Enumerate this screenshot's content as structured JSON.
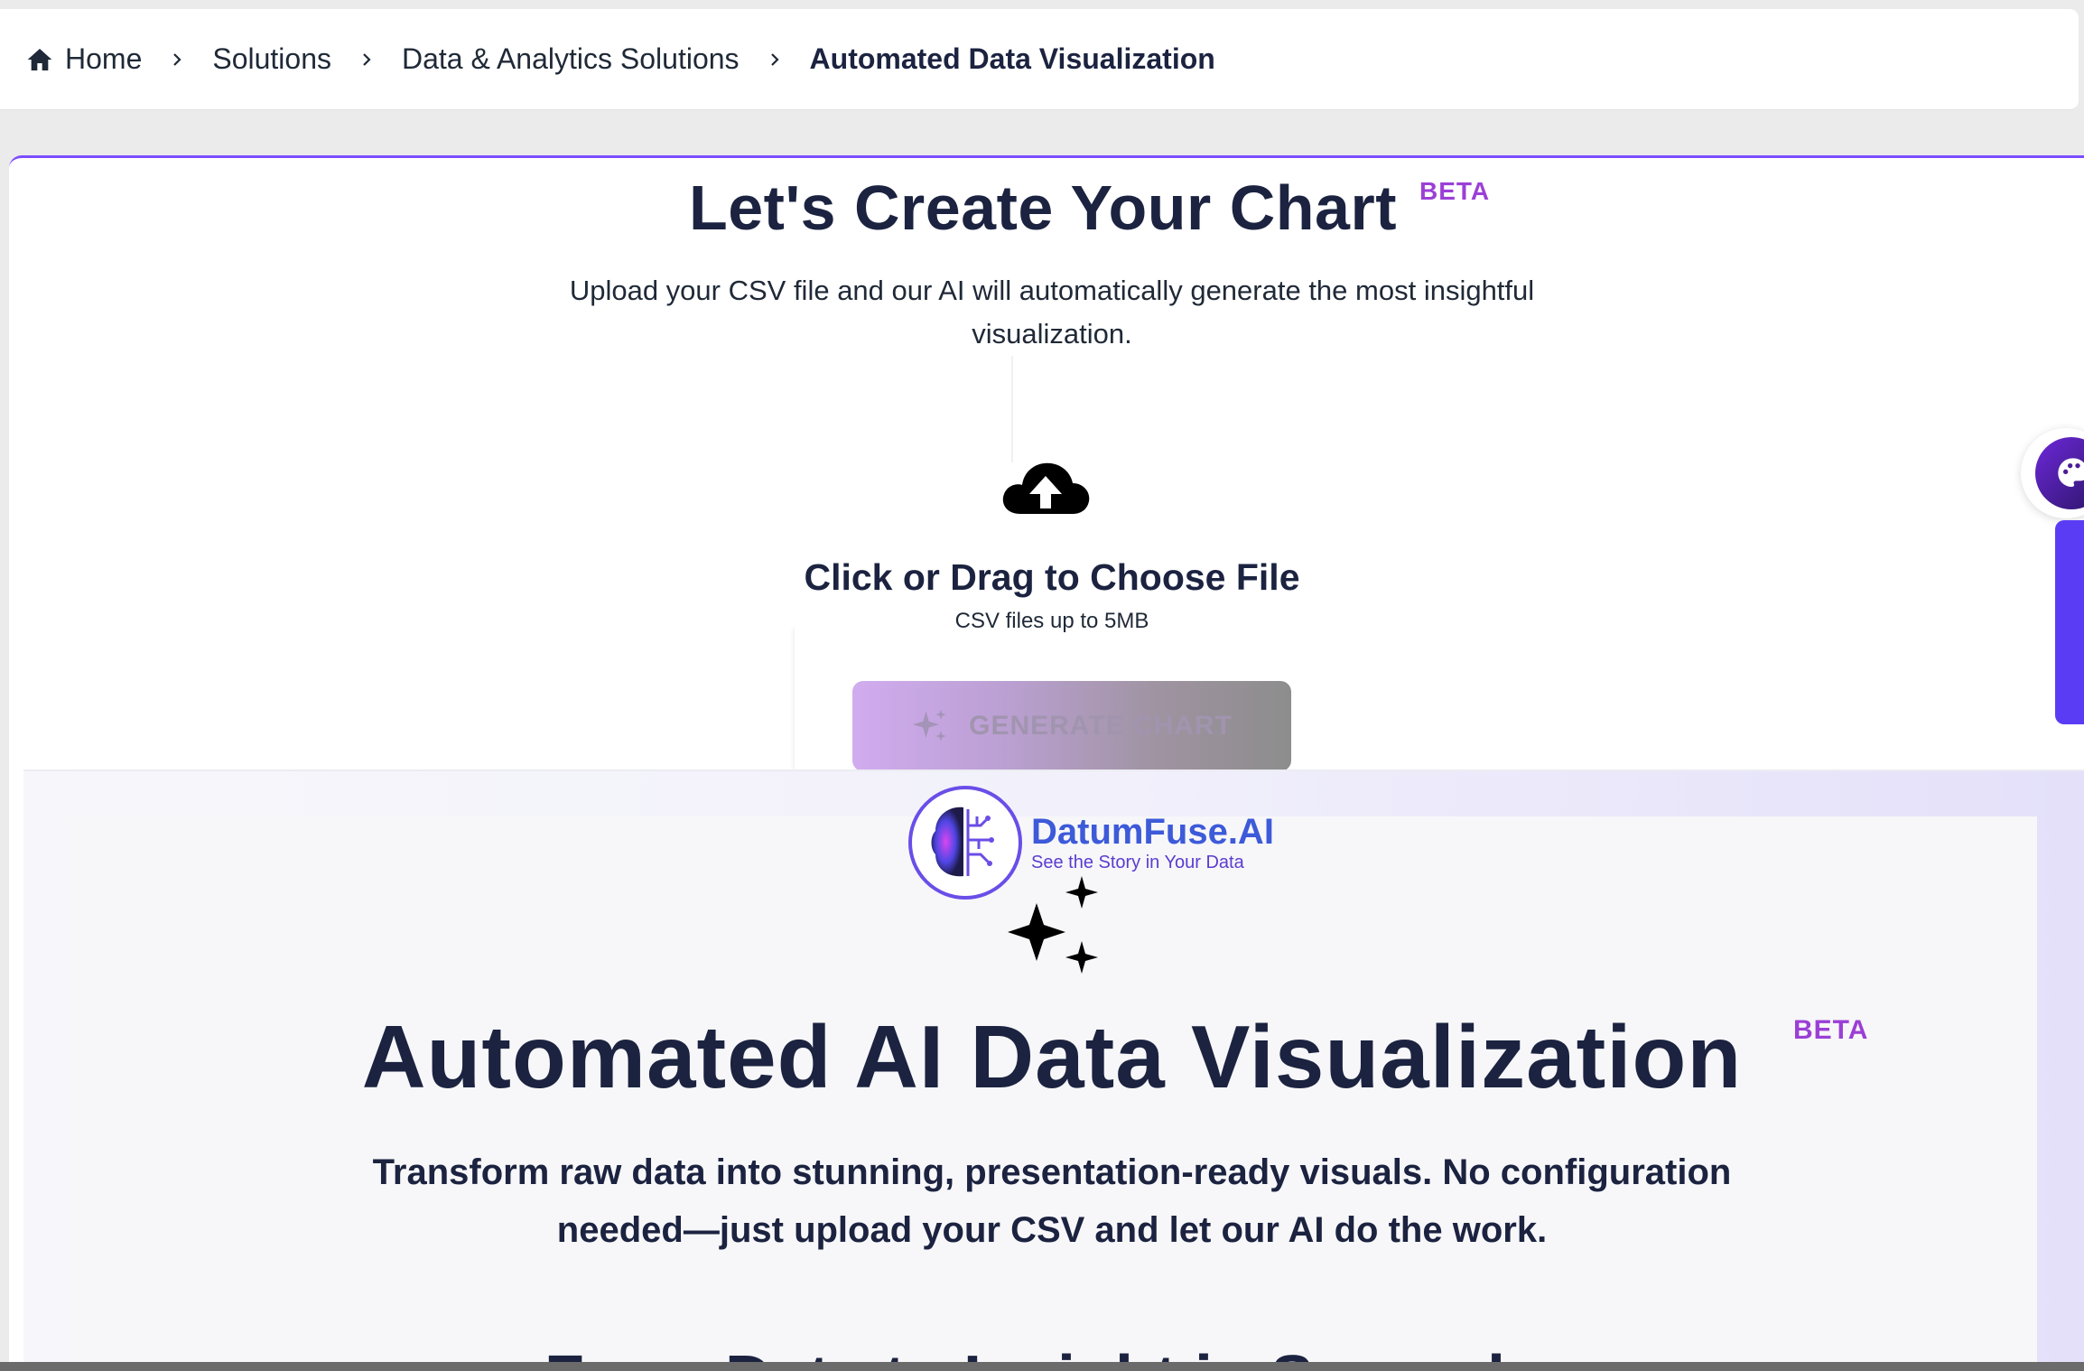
{
  "breadcrumb": {
    "items": [
      {
        "label": "Home",
        "icon": "home-icon"
      },
      {
        "label": "Solutions"
      },
      {
        "label": "Data & Analytics Solutions"
      },
      {
        "label": "Automated Data Visualization",
        "current": true
      }
    ]
  },
  "upload_card": {
    "title": "Let's Create Your Chart",
    "beta": "BETA",
    "subtitle": "Upload your CSV file and our AI will automatically generate the most insightful visualization.",
    "dropzone_title": "Click or Drag to Choose File",
    "dropzone_hint": "CSV files up to 5MB",
    "generate_label": "GENERATE CHART"
  },
  "hero": {
    "brand_name": "DatumFuse.AI",
    "brand_tagline": "See the Story in Your Data",
    "title": "Automated AI Data Visualization",
    "beta": "BETA",
    "description": "Transform raw data into stunning, presentation-ready visuals. No configuration needed—just upload your CSV and let our AI do the work.",
    "next_heading": "From Data to Insight in Seconds"
  },
  "colors": {
    "accent": "#9b3fd6",
    "navy": "#1b2340",
    "brand_blue": "#3d5ad9",
    "side_tab": "#5b3cf5"
  }
}
